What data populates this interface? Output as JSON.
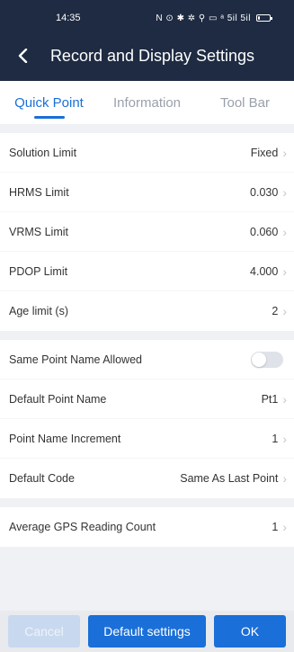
{
  "status_bar": {
    "time": "14:35",
    "icons_text": "N ⊙ ✱ ✲ ⚲ ▭ ᵃ 5il 5il",
    "battery_level": 0.15
  },
  "header": {
    "title": "Record and Display Settings",
    "back_icon": "chevron-left-icon"
  },
  "tabs": [
    {
      "label": "Quick Point",
      "active": true
    },
    {
      "label": "Information",
      "active": false
    },
    {
      "label": "Tool Bar",
      "active": false
    }
  ],
  "section1": [
    {
      "label": "Solution Limit",
      "value": "Fixed"
    },
    {
      "label": "HRMS Limit",
      "value": "0.030"
    },
    {
      "label": "VRMS Limit",
      "value": "0.060"
    },
    {
      "label": "PDOP Limit",
      "value": "4.000"
    },
    {
      "label": "Age limit (s)",
      "value": "2"
    }
  ],
  "section2": {
    "toggle_row": {
      "label": "Same Point Name Allowed",
      "enabled": false
    },
    "rows": [
      {
        "label": "Default Point Name",
        "value": "Pt1"
      },
      {
        "label": "Point Name Increment",
        "value": "1"
      },
      {
        "label": "Default Code",
        "value": "Same As Last Point"
      }
    ]
  },
  "section3": [
    {
      "label": "Average GPS Reading Count",
      "value": "1"
    }
  ],
  "footer": {
    "cancel_label": "Cancel",
    "default_label": "Default settings",
    "ok_label": "OK"
  },
  "colors": {
    "header_bg": "#1e2b42",
    "accent": "#1a6fd8",
    "page_bg": "#f0f1f4"
  }
}
